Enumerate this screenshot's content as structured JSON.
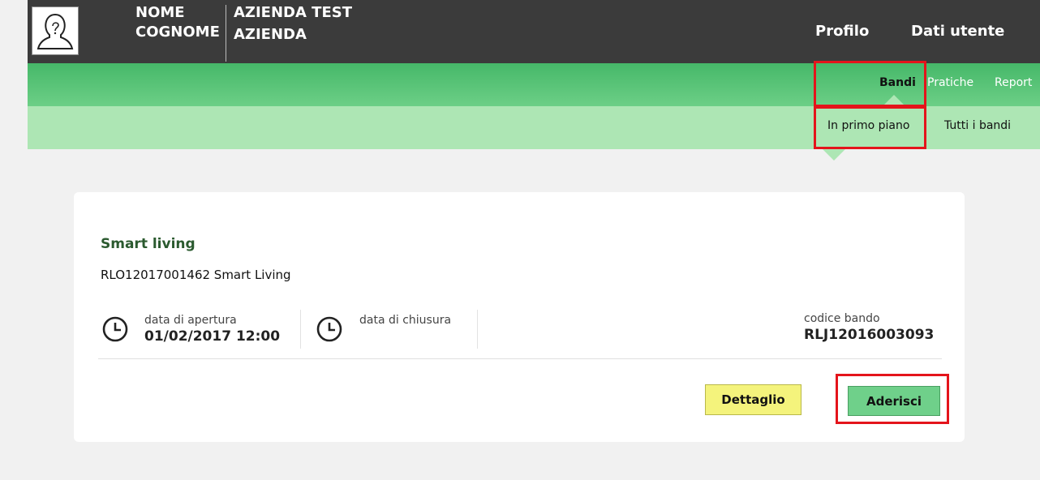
{
  "header": {
    "user_first": "NOME",
    "user_last": "COGNOME",
    "company_line1": "AZIENDA TEST",
    "company_line2": "AZIENDA",
    "nav_profilo": "Profilo",
    "nav_dati_utente": "Dati utente"
  },
  "menu": {
    "items": [
      {
        "label": "Bandi"
      },
      {
        "label": "Pratiche"
      },
      {
        "label": "Report"
      }
    ]
  },
  "submenu": {
    "items": [
      {
        "label": "In primo piano"
      },
      {
        "label": "Tutti i bandi"
      }
    ]
  },
  "bando": {
    "title": "Smart living",
    "subtitle": "RLO12017001462 Smart Living",
    "apertura_label": "data di apertura",
    "apertura_value": "01/02/2017 12:00",
    "chiusura_label": "data di chiusura",
    "codice_label": "codice bando",
    "codice_value": "RLJ12016003093",
    "btn_dettaglio": "Dettaglio",
    "btn_aderisci": "Aderisci"
  },
  "colors": {
    "header_bg": "#3b3b3b",
    "menu_green": "#5cc67a",
    "submenu_green": "#ade6b4",
    "title_green": "#2b5a2f",
    "highlight_red": "#e4141b",
    "btn_yellow": "#f4f37c",
    "btn_green": "#6fd08a"
  },
  "icons": {
    "avatar": "user-avatar-icon",
    "clock": "clock-icon"
  }
}
